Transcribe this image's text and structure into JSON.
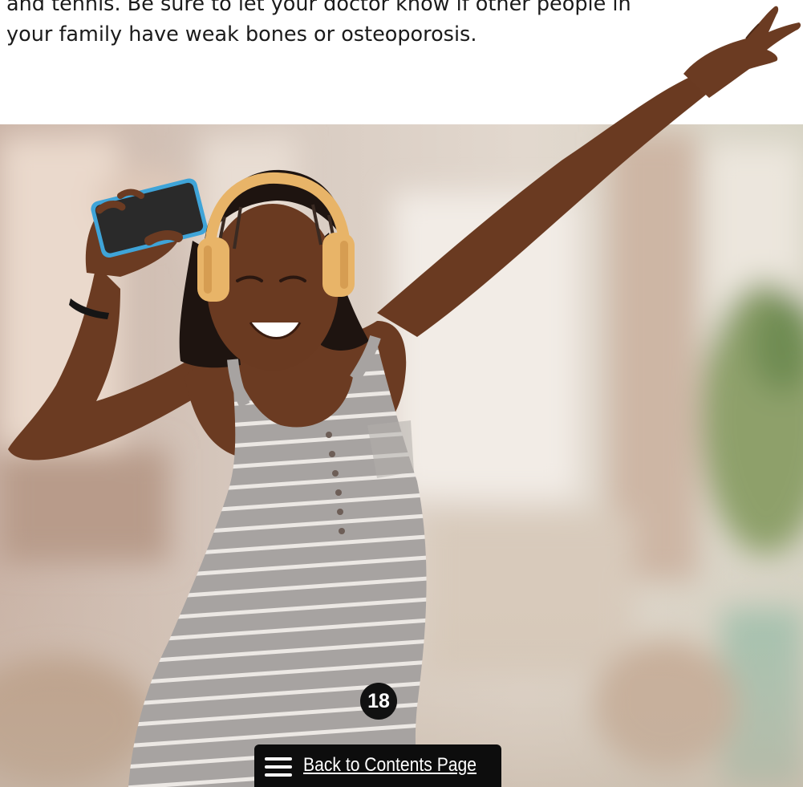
{
  "body_text": {
    "line1": "and tennis. Be sure to let your doctor know if other people in",
    "line2": "your family have weak bones or osteoporosis."
  },
  "photo": {
    "subject": "woman dancing with headphones and phone"
  },
  "page_number": "18",
  "back_link": {
    "label": "Back to Contents Page",
    "icon": "menu-icon"
  },
  "colors": {
    "text": "#1b1b1b",
    "page_badge": "#111111",
    "back_bar": "#0d0d0d",
    "headphones": "#e8b468",
    "dress": "#a9a6a4",
    "skin": "#6b3b22"
  }
}
